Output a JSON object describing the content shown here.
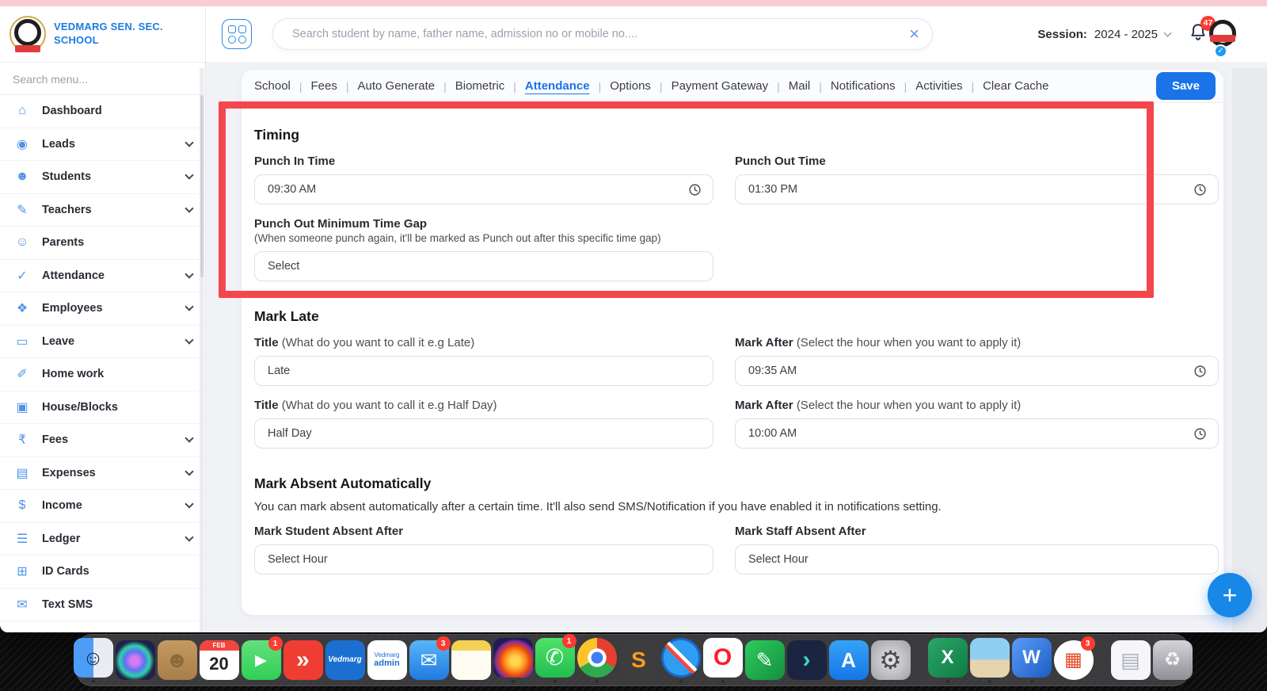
{
  "colors": {
    "accent_blue": "#1a73e8",
    "annotation_red": "#f4474d",
    "top_strip_pink": "#f6cdd1",
    "sidebar_icon_blue": "#4f94e5"
  },
  "icons": {
    "close": "×",
    "plus": "+",
    "check": "✓",
    "tab_sep": "|"
  },
  "sidebar": {
    "school_name": "VEDMARG SEN. SEC. SCHOOL",
    "search_placeholder": "Search menu...",
    "items": [
      {
        "icon": "home-icon",
        "glyph": "⌂",
        "label": "Dashboard",
        "chevron": false
      },
      {
        "icon": "leads-icon",
        "glyph": "◉",
        "label": "Leads",
        "chevron": true
      },
      {
        "icon": "students-icon",
        "glyph": "☻",
        "label": "Students",
        "chevron": true
      },
      {
        "icon": "teachers-icon",
        "glyph": "✎",
        "label": "Teachers",
        "chevron": true
      },
      {
        "icon": "parents-icon",
        "glyph": "☺",
        "label": "Parents",
        "chevron": false
      },
      {
        "icon": "attendance-icon",
        "glyph": "✓",
        "label": "Attendance",
        "chevron": true
      },
      {
        "icon": "employees-icon",
        "glyph": "❖",
        "label": "Employees",
        "chevron": true
      },
      {
        "icon": "leave-icon",
        "glyph": "▭",
        "label": "Leave",
        "chevron": true
      },
      {
        "icon": "homework-icon",
        "glyph": "✐",
        "label": "Home work",
        "chevron": false
      },
      {
        "icon": "house-blocks-icon",
        "glyph": "▣",
        "label": "House/Blocks",
        "chevron": false
      },
      {
        "icon": "fees-icon",
        "glyph": "₹",
        "label": "Fees",
        "chevron": true
      },
      {
        "icon": "expenses-icon",
        "glyph": "▤",
        "label": "Expenses",
        "chevron": true
      },
      {
        "icon": "income-icon",
        "glyph": "$",
        "label": "Income",
        "chevron": true
      },
      {
        "icon": "ledger-icon",
        "glyph": "☰",
        "label": "Ledger",
        "chevron": true
      },
      {
        "icon": "id-cards-icon",
        "glyph": "⊞",
        "label": "ID Cards",
        "chevron": false
      },
      {
        "icon": "text-sms-icon",
        "glyph": "✉",
        "label": "Text SMS",
        "chevron": false
      },
      {
        "icon": "menu-icon",
        "glyph": "▥",
        "label": "",
        "chevron": false
      }
    ]
  },
  "header": {
    "search_placeholder": "Search student by name, father name, admission no or mobile no....",
    "session_label": "Session:",
    "session_value": "2024 - 2025",
    "notification_count": "47"
  },
  "tabs": {
    "items": [
      {
        "label": "School",
        "sep": true
      },
      {
        "label": "Fees",
        "sep": true
      },
      {
        "label": "Auto Generate",
        "sep": true
      },
      {
        "label": "Biometric",
        "sep": true
      },
      {
        "label": "Attendance",
        "sep": true,
        "active": true
      },
      {
        "label": "Options",
        "sep": true
      },
      {
        "label": "Payment Gateway",
        "sep": true
      },
      {
        "label": "Mail",
        "sep": true
      },
      {
        "label": "Notifications",
        "sep": true
      },
      {
        "label": "Activities",
        "sep": true
      },
      {
        "label": "Clear Cache",
        "sep": false
      }
    ],
    "save_label": "Save"
  },
  "form": {
    "timing": {
      "heading": "Timing",
      "punch_in_label": "Punch In Time",
      "punch_in_value": "09:30 AM",
      "punch_out_label": "Punch Out Time",
      "punch_out_value": "01:30 PM",
      "gap_label": "Punch Out Minimum Time Gap",
      "gap_help": "(When someone punch again, it'll be marked as Punch out after this specific time gap)",
      "gap_value": "Select"
    },
    "mark_late": {
      "heading": "Mark Late",
      "title1_label": "Title",
      "title1_help": "(What do you want to call it e.g Late)",
      "title1_value": "Late",
      "after1_label": "Mark After",
      "after1_help": "(Select the hour when you want to apply it)",
      "after1_value": "09:35 AM",
      "title2_label": "Title",
      "title2_help": "(What do you want to call it e.g Half Day)",
      "title2_value": "Half Day",
      "after2_label": "Mark After",
      "after2_help": "(Select the hour when you want to apply it)",
      "after2_value": "10:00 AM"
    },
    "mark_absent": {
      "heading": "Mark Absent Automatically",
      "description": "You can mark absent automatically after a certain time. It'll also send SMS/Notification if you have enabled it in notifications setting.",
      "student_label": "Mark Student Absent After",
      "student_value": "Select Hour",
      "staff_label": "Mark Staff Absent After",
      "staff_value": "Select Hour"
    }
  },
  "dock": {
    "items": [
      {
        "icon": "finder-dock-icon",
        "bg": "linear-gradient(90deg,#4d9df6 50%,#e9ecf2 50%)",
        "glyph": "☺",
        "fg": "#16233f",
        "size": 26,
        "dot": true
      },
      {
        "icon": "siri-dock-icon",
        "bg": "radial-gradient(circle at 48% 52%, #d97bf0 0 14%, #5a73f2 34%, #2fd3a8 52%, #20224a 68%)",
        "glyph": ""
      },
      {
        "icon": "contacts-dock-icon",
        "bg": "linear-gradient(#c49a62,#a97e48)",
        "glyph": "☻",
        "fg": "#8a6a3c",
        "size": 28
      },
      {
        "icon": "calendar-dock-icon",
        "bg": "#ffffff",
        "top": "FEB",
        "topBg": "#f2453d",
        "glyph": "20",
        "fg": "#222222",
        "size": 22,
        "weight": "700",
        "pad": true
      },
      {
        "icon": "facetime-dock-icon",
        "bg": "linear-gradient(#63e07c,#2fcf55)",
        "glyph": "▸",
        "fg": "#ffffff",
        "size": 30,
        "badge": "1"
      },
      {
        "icon": "red-diamond-app-dock-icon",
        "bg": "#ef3d33",
        "glyph": "»",
        "fg": "#ffffff",
        "size": 30,
        "weight": "700"
      },
      {
        "icon": "vedmarg-dock-icon",
        "bg": "#1b6fd0",
        "glyph": "Vedmarg",
        "fg": "#ffffff",
        "size": 10,
        "style": "italic",
        "weight": "700"
      },
      {
        "icon": "vedmarg-admin-dock-icon",
        "bg": "#ffffff",
        "glyph": "Vedmarg",
        "fg": "#1b6fd0",
        "size": 8,
        "sub": "admin",
        "subColor": "#1b6fd0"
      },
      {
        "icon": "mail-dock-icon",
        "bg": "linear-gradient(#58b6f8,#1f7ae0)",
        "glyph": "✉",
        "fg": "#ffffff",
        "size": 26,
        "badge": "3"
      },
      {
        "icon": "notes-dock-icon",
        "bg": "#fffdf2",
        "top": " ",
        "topBg": "#f4d154",
        "glyph": ""
      },
      {
        "icon": "firefox-dock-icon",
        "bg": "radial-gradient(circle at 55% 58%, #ffd54a 0 14%, #ff9022 32%, #e3450f 48%, #7b2ea8 62%, #241a4f 70%)",
        "glyph": "",
        "dot": true
      },
      {
        "icon": "whatsapp-dock-icon",
        "bg": "linear-gradient(#52e16b,#1fbf4e)",
        "glyph": "✆",
        "fg": "#ffffff",
        "size": 28,
        "badge": "1",
        "dot": true
      },
      {
        "icon": "chrome-dock-icon",
        "radius": "50%",
        "bg": "radial-gradient(circle, #3e7ff0 0 20%, #ffffff 22% 32%, rgba(255,255,255,0) 34%), conic-gradient(#e5402f 0 120deg, #2faa4f 120deg 240deg, #fcc32c 240deg 360deg)",
        "glyph": "",
        "dot": true
      },
      {
        "icon": "sublime-text-dock-icon",
        "bg": "#3d3d3d",
        "glyph": "S",
        "fg": "#ff9a1f",
        "size": 28,
        "weight": "700"
      },
      {
        "icon": "safari-dock-icon",
        "radius": "50%",
        "bg": "linear-gradient(45deg, rgba(0,0,0,0) 44%, #ff4433 44% 50%, #ffffff 50% 56%, rgba(0,0,0,0) 56%), radial-gradient(circle, #bfe3ff 0 8%, #2f9df2 9% 62%, #1669cc 63%)",
        "glyph": "",
        "dot": true
      },
      {
        "icon": "opera-dock-icon",
        "bg": "#ffffff",
        "glyph": "O",
        "fg": "#ff1b2d",
        "size": 30,
        "weight": "800",
        "dot": true
      },
      {
        "icon": "green-pencil-app-dock-icon",
        "bg": "linear-gradient(135deg,#2ecc5e,#148f3e)",
        "glyph": "✎",
        "fg": "#ffffff",
        "size": 26
      },
      {
        "icon": "filmora-dock-icon",
        "bg": "#1b2440",
        "glyph": "›",
        "fg": "#35e0c8",
        "size": 30,
        "weight": "700"
      },
      {
        "icon": "app-store-dock-icon",
        "bg": "linear-gradient(#35a3f6,#1576e8)",
        "glyph": "A",
        "fg": "#ffffff",
        "size": 26,
        "weight": "700"
      },
      {
        "icon": "system-settings-dock-icon",
        "bg": "radial-gradient(#e3e3e6,#9fa0a6)",
        "glyph": "⚙",
        "fg": "#4a4a50",
        "size": 32
      },
      {
        "divider": true
      },
      {
        "icon": "excel-dock-icon",
        "bg": "linear-gradient(135deg,#2ca56a,#0f7c43)",
        "glyph": "X",
        "fg": "#ffffff",
        "size": 24,
        "weight": "700",
        "dot": true
      },
      {
        "icon": "photos-dock-icon",
        "bg": "linear-gradient(#8fd0f2 55%, #e6d4ae 55%)",
        "glyph": "",
        "dot": true
      },
      {
        "icon": "word-dock-icon",
        "bg": "linear-gradient(135deg,#5a9df8,#1d5cc2)",
        "glyph": "W",
        "fg": "#ffffff",
        "size": 24,
        "weight": "700",
        "dot": true
      },
      {
        "icon": "microsoft-365-dock-icon",
        "bg": "#ffffff",
        "radius": "50%",
        "glyph": "▦",
        "fg": "#e8472b",
        "size": 24,
        "badge": "3"
      },
      {
        "divider": true
      },
      {
        "icon": "documents-dock-icon",
        "bg": "#f6f6f8",
        "glyph": "▤",
        "fg": "#a9b0bc",
        "size": 26
      },
      {
        "icon": "trash-dock-icon",
        "bg": "linear-gradient(rgba(225,225,230,.92), rgba(150,150,158,.92))",
        "glyph": "♻",
        "fg": "#f4f4f6",
        "size": 24
      }
    ]
  }
}
